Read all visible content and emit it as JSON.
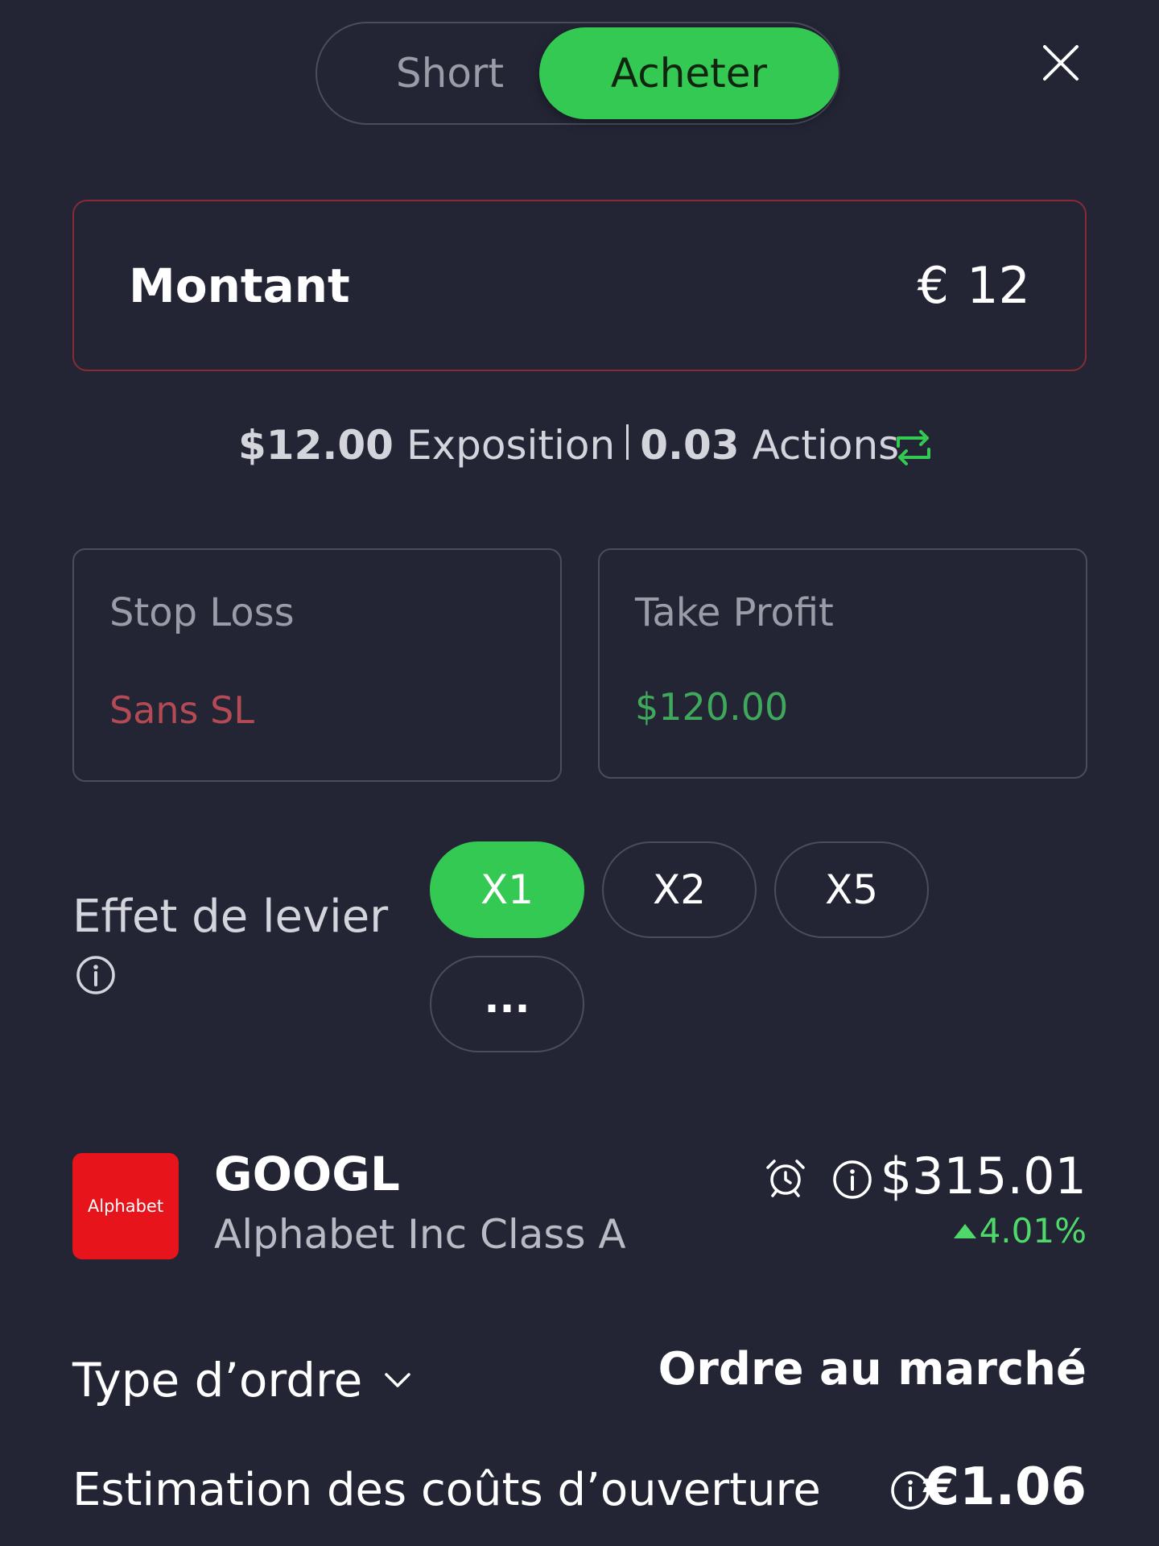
{
  "toggle": {
    "short_label": "Short",
    "buy_label": "Acheter",
    "selected": "Acheter"
  },
  "amount": {
    "label": "Montant",
    "currency": "€",
    "value": "12"
  },
  "exposure": {
    "value": "$12.00",
    "label": "Exposition",
    "shares_value": "0.03",
    "shares_label": "Actions"
  },
  "stop_loss": {
    "title": "Stop Loss",
    "value": "Sans SL"
  },
  "take_profit": {
    "title": "Take Profit",
    "value": "$120.00"
  },
  "leverage": {
    "label": "Effet de levier",
    "options": [
      "X1",
      "X2",
      "X5",
      "..."
    ],
    "selected": "X1"
  },
  "stock": {
    "logo_text": "Alphabet",
    "ticker": "GOOGL",
    "name": "Alphabet Inc Class A",
    "price": "$315.01",
    "change": "4.01%"
  },
  "order": {
    "type_label": "Type d’ordre",
    "type_value": "Ordre au marché"
  },
  "costs": {
    "label": "Estimation des coûts d’ouverture",
    "value": "€1.06"
  },
  "colors": {
    "background": "#232535",
    "accent_green": "#33c952",
    "stop_loss_red": "#b54a55",
    "take_profit_green": "#3fa85a",
    "positive_change": "#4fd96a",
    "logo_red": "#e8141c"
  }
}
